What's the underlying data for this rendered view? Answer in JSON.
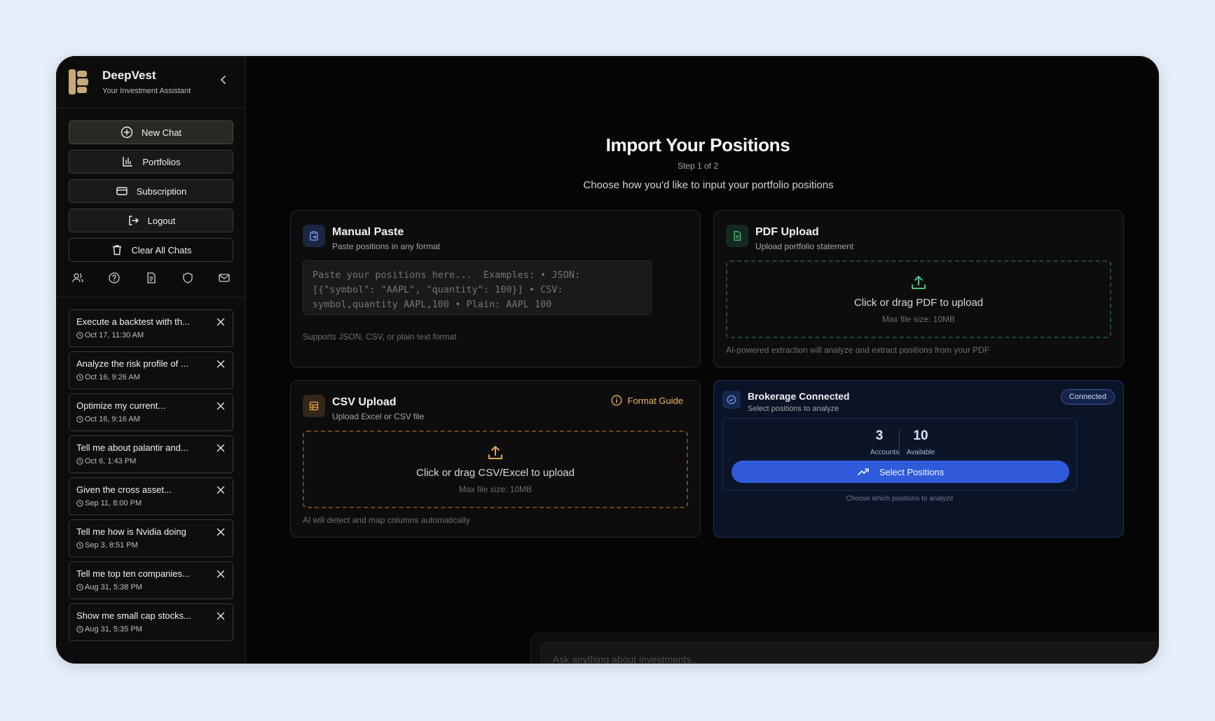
{
  "app": {
    "name": "DeepVest",
    "tagline": "Your Investment Assistant"
  },
  "sidebar": {
    "buttons": {
      "new_chat": "New Chat",
      "portfolios": "Portfolios",
      "subscription": "Subscription",
      "logout": "Logout",
      "clear_all": "Clear All Chats"
    },
    "icon_row": [
      "users-icon",
      "help-circle-icon",
      "document-icon",
      "shield-icon",
      "mail-icon"
    ],
    "chats": [
      {
        "title": "Execute a backtest with th...",
        "time": "Oct 17, 11:30 AM"
      },
      {
        "title": "Analyze the risk profile of ...",
        "time": "Oct 16, 9:26 AM"
      },
      {
        "title": "Optimize my current...",
        "time": "Oct 16, 9:16 AM"
      },
      {
        "title": "Tell me about palantir and...",
        "time": "Oct 6, 1:43 PM"
      },
      {
        "title": "Given the cross asset...",
        "time": "Sep 11, 8:00 PM"
      },
      {
        "title": "Tell me how is Nvidia doing",
        "time": "Sep 3, 8:51 PM"
      },
      {
        "title": "Tell me top ten companies...",
        "time": "Aug 31, 5:38 PM"
      },
      {
        "title": "Show me small cap stocks...",
        "time": "Aug 31, 5:35 PM"
      }
    ]
  },
  "modal": {
    "title": "Import Your Positions",
    "step": "Step 1 of 2",
    "description": "Choose how you'd like to input your portfolio positions",
    "manual": {
      "title": "Manual Paste",
      "subtitle": "Paste positions in any format",
      "placeholder": "Paste your positions here...  Examples: • JSON: [{\"symbol\": \"AAPL\", \"quantity\": 100}] • CSV: symbol,quantity AAPL,100 • Plain: AAPL 100",
      "note": "Supports JSON, CSV, or plain text format"
    },
    "pdf": {
      "title": "PDF Upload",
      "subtitle": "Upload portfolio statement",
      "drop_text": "Click or drag PDF to upload",
      "drop_sub": "Max file size: 10MB",
      "note": "AI-powered extraction will analyze and extract positions from your PDF"
    },
    "csv": {
      "title": "CSV Upload",
      "subtitle": "Upload Excel or CSV file",
      "format_guide": "Format Guide",
      "drop_text": "Click or drag CSV/Excel to upload",
      "drop_sub": "Max file size: 10MB",
      "note": "AI will detect and map columns automatically"
    },
    "brokerage": {
      "title": "Brokerage Connected",
      "subtitle": "Select positions to analyze",
      "badge": "Connected",
      "accounts_value": "3",
      "accounts_label": "Accounts",
      "available_value": "10",
      "available_label": "Available",
      "button": "Select Positions",
      "note": "Choose which positions to analyze"
    }
  },
  "chat_input": {
    "placeholder": "Ask anything about investments..."
  },
  "colors": {
    "accent_gold": "#c9a877",
    "accent_blue": "#2f5bda",
    "pdf_green": "#4fbf85",
    "csv_orange": "#e9a04a"
  }
}
